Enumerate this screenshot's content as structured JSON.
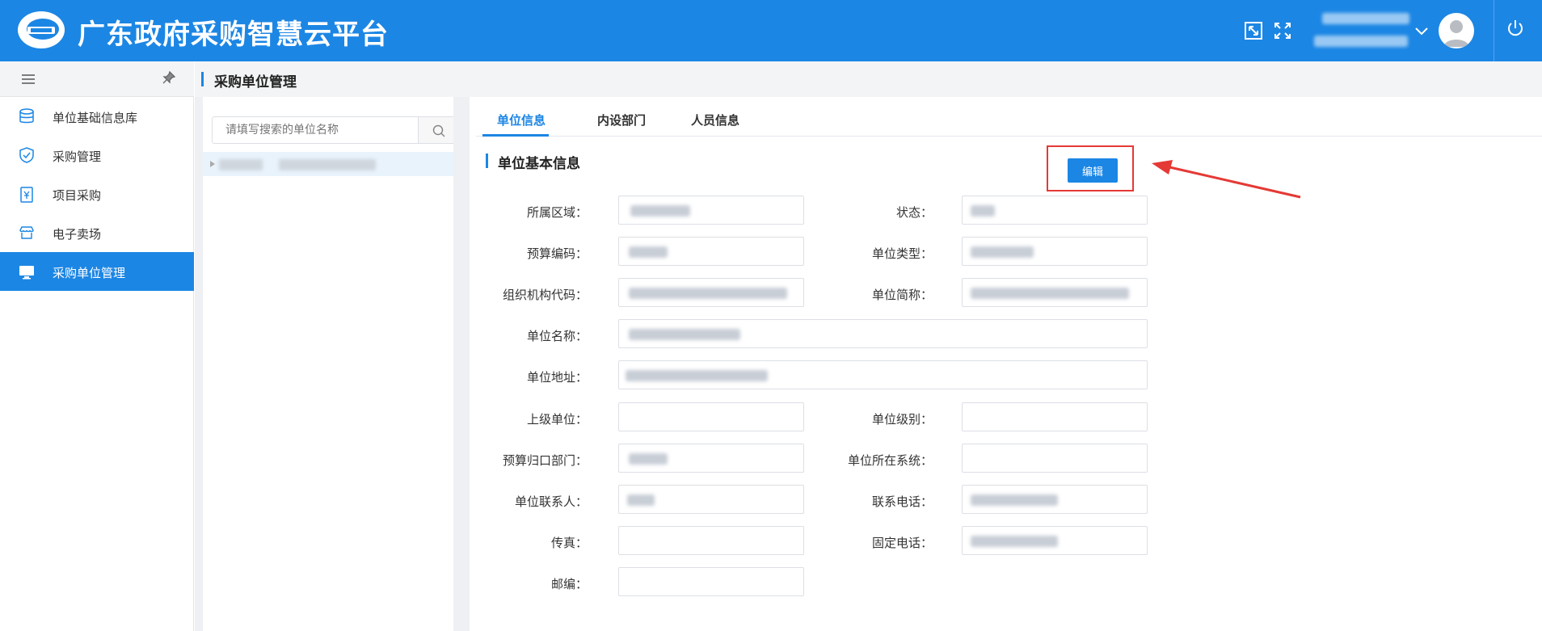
{
  "app": {
    "title": "广东政府采购智慧云平台",
    "accent_color": "#1c86e4"
  },
  "header": {
    "icons": [
      "external-window-icon",
      "fullscreen-icon",
      "chevron-down-icon",
      "avatar-icon",
      "power-icon"
    ]
  },
  "sidebar": {
    "items": [
      {
        "label": "单位基础信息库",
        "icon": "database-icon",
        "active": false
      },
      {
        "label": "采购管理",
        "icon": "shield-icon",
        "active": false
      },
      {
        "label": "项目采购",
        "icon": "clipboard-yen-icon",
        "active": false
      },
      {
        "label": "电子卖场",
        "icon": "store-icon",
        "active": false
      },
      {
        "label": "采购单位管理",
        "icon": "monitor-icon",
        "active": true
      }
    ]
  },
  "breadcrumb": {
    "title": "采购单位管理"
  },
  "tree": {
    "search_placeholder": "请填写搜索的单位名称"
  },
  "tabs": [
    {
      "label": "单位信息",
      "active": true
    },
    {
      "label": "内设部门",
      "active": false
    },
    {
      "label": "人员信息",
      "active": false
    }
  ],
  "section": {
    "title": "单位基本信息",
    "edit_label": "编辑"
  },
  "form": {
    "region_label": "所属区域：",
    "status_label": "状态：",
    "budget_code_label": "预算编码：",
    "unit_type_label": "单位类型：",
    "org_code_label": "组织机构代码：",
    "short_name_label": "单位简称：",
    "unit_name_label": "单位名称：",
    "address_label": "单位地址：",
    "parent_unit_label": "上级单位：",
    "unit_level_label": "单位级别：",
    "budget_dept_label": "预算归口部门：",
    "system_label": "单位所在系统：",
    "contact_label": "单位联系人：",
    "phone_label": "联系电话：",
    "fax_label": "传真：",
    "landline_label": "固定电话：",
    "postcode_label": "邮编："
  }
}
